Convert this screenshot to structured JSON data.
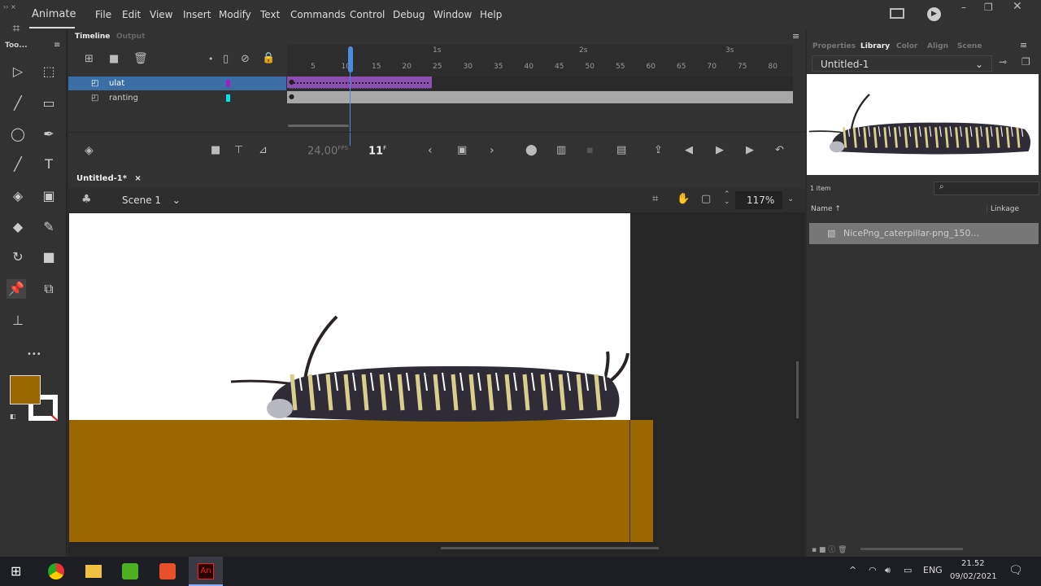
{
  "app": {
    "name": "Animate",
    "menus": [
      "File",
      "Edit",
      "View",
      "Insert",
      "Modify",
      "Text",
      "Commands",
      "Control",
      "Debug",
      "Window",
      "Help"
    ]
  },
  "toolbar": {
    "title": "Too...",
    "more": "•••",
    "fill_color": "#9a6700"
  },
  "timeline": {
    "tabs": [
      "Timeline",
      "Output"
    ],
    "layers": [
      {
        "name": "ulat",
        "color": "#a020c0",
        "selected": true
      },
      {
        "name": "ranting",
        "color": "#00e5e5",
        "selected": false
      }
    ],
    "ruler": [
      "5",
      "10",
      "15",
      "20",
      "25",
      "30",
      "35",
      "40",
      "45",
      "50",
      "55",
      "60",
      "65",
      "70",
      "75",
      "80"
    ],
    "seconds": [
      "1s",
      "2s",
      "3s"
    ],
    "fps": "24,00",
    "fps_unit": "FPS",
    "frame": "11",
    "frame_unit": "F",
    "current_frame": 11,
    "ulat_frames": 24
  },
  "document": {
    "tab": "Untitled-1*",
    "close": "×",
    "scene": "Scene 1",
    "zoom": "117%"
  },
  "panel": {
    "tabs": [
      "Properties",
      "Library",
      "Color",
      "Align",
      "Scene"
    ],
    "active_tab": "Library",
    "library_select": "Untitled-1",
    "count": "1 item",
    "col_name": "Name",
    "col_linkage": "Linkage",
    "items": [
      "NicePng_caterpillar-png_150..."
    ]
  },
  "taskbar": {
    "lang": "ENG",
    "time": "21.52",
    "date": "09/02/2021"
  },
  "colors": {
    "stage_ground": "#9a6700",
    "layer_selected": "#3a6ea5",
    "frames_purple": "#8a4fb0"
  }
}
